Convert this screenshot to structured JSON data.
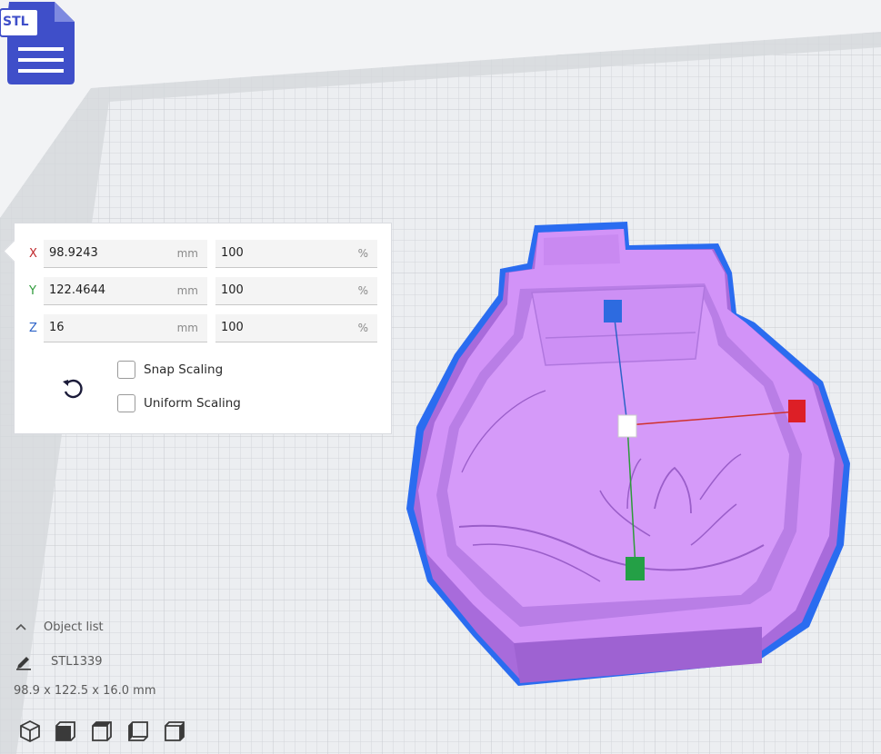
{
  "badge": {
    "label": "STL"
  },
  "scale_panel": {
    "rows": [
      {
        "axis": "X",
        "mm_value": "98.9243",
        "mm_unit": "mm",
        "percent_value": "100",
        "percent_unit": "%",
        "color": "#c0282c"
      },
      {
        "axis": "Y",
        "mm_value": "122.4644",
        "mm_unit": "mm",
        "percent_value": "100",
        "percent_unit": "%",
        "color": "#2e9a3a"
      },
      {
        "axis": "Z",
        "mm_value": "16",
        "mm_unit": "mm",
        "percent_value": "100",
        "percent_unit": "%",
        "color": "#2d63c8"
      }
    ],
    "snap_scaling_label": "Snap Scaling",
    "snap_scaling_checked": false,
    "uniform_scaling_label": "Uniform Scaling",
    "uniform_scaling_checked": false,
    "reset_icon": "reset-icon"
  },
  "object_list": {
    "header": "Object list",
    "object_name": "STL1339",
    "dimensions": "98.9 x 122.5 x 16.0 mm"
  },
  "view_buttons": [
    "3d-view-icon",
    "front-view-icon",
    "top-view-icon",
    "left-view-icon",
    "right-view-icon"
  ],
  "colors": {
    "model": "#cf8cf7",
    "model_shadow": "#a667d8",
    "selection_outline": "#2a6cf0",
    "build_plate_grid": "#cbced3",
    "badge": "#3f4fc9"
  }
}
